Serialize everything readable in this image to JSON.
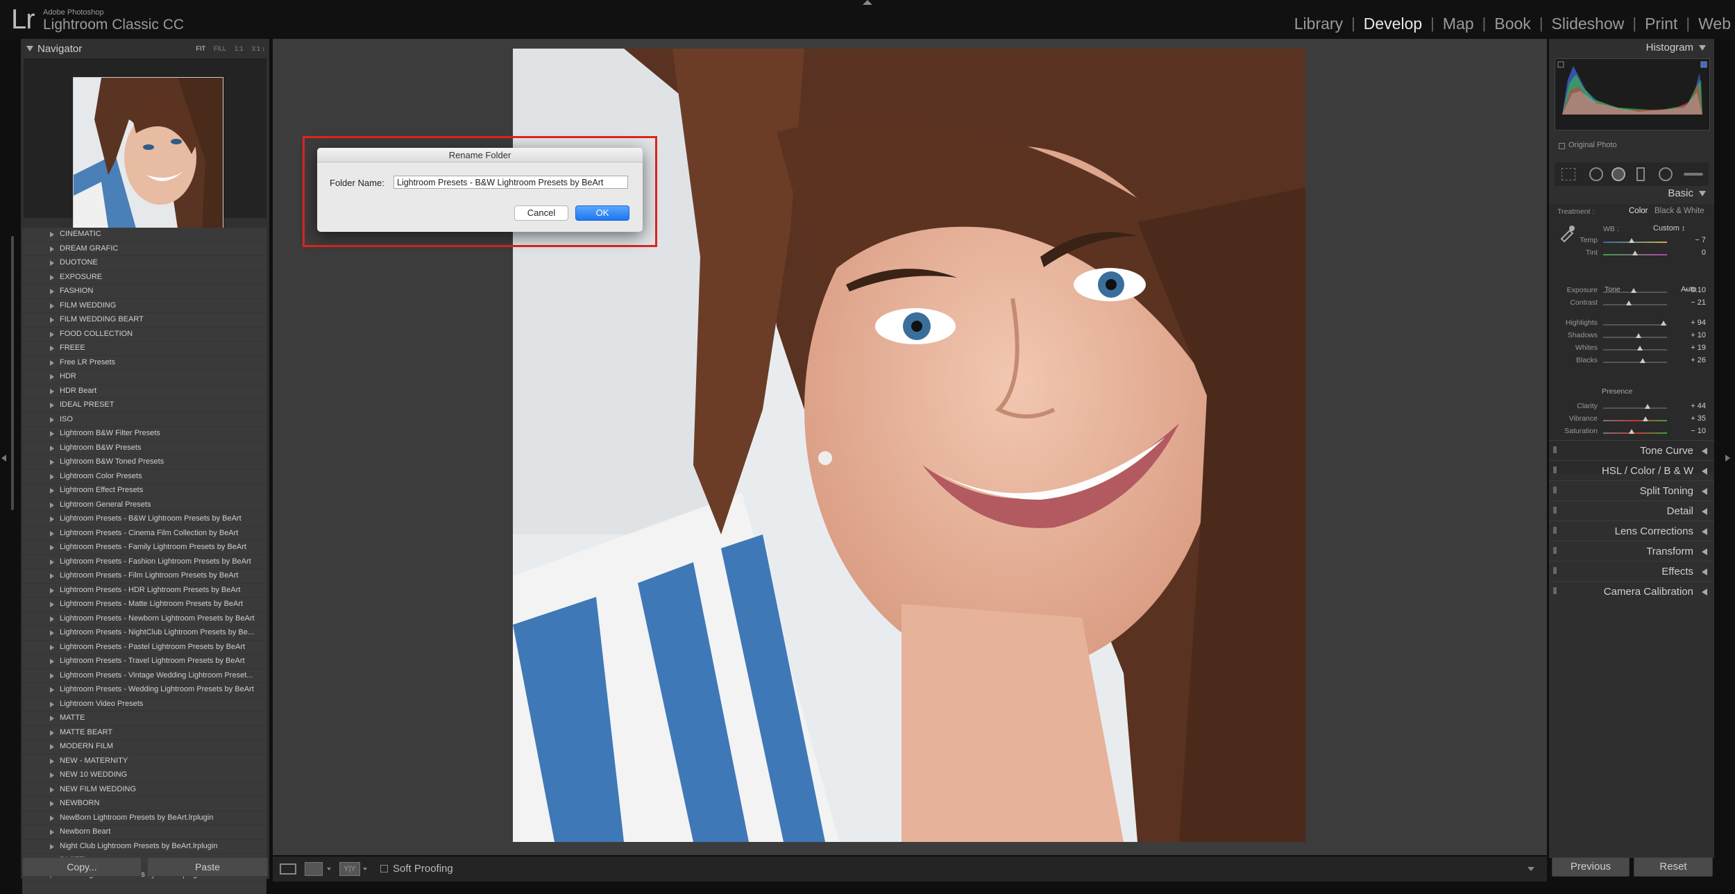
{
  "app": {
    "logo": "Lr",
    "vendor": "Adobe Photoshop",
    "name": "Lightroom Classic CC"
  },
  "modules": [
    {
      "label": "Library",
      "active": false
    },
    {
      "label": "Develop",
      "active": true
    },
    {
      "label": "Map",
      "active": false
    },
    {
      "label": "Book",
      "active": false
    },
    {
      "label": "Slideshow",
      "active": false
    },
    {
      "label": "Print",
      "active": false
    },
    {
      "label": "Web",
      "active": false
    }
  ],
  "navigator": {
    "title": "Navigator",
    "zoom_options": [
      "FIT",
      "FILL",
      "1:1",
      "3:1 ↕"
    ],
    "selected_zoom": "FIT"
  },
  "presets": [
    "CINEMATIC",
    "DREAM GRAFIC",
    "DUOTONE",
    "EXPOSURE",
    "FASHION",
    "FILM WEDDING",
    "FILM WEDDING BEART",
    "FOOD COLLECTION",
    "FREEE",
    "Free LR Presets",
    "HDR",
    "HDR Beart",
    "IDEAL PRESET",
    "ISO",
    "Lightroom B&W Filter Presets",
    "Lightroom B&W Presets",
    "Lightroom B&W Toned Presets",
    "Lightroom Color Presets",
    "Lightroom Effect Presets",
    "Lightroom General Presets",
    "Lightroom Presets - B&W Lightroom Presets by BeArt",
    "Lightroom Presets - Cinema Film Collection by BeArt",
    "Lightroom Presets - Family Lightroom Presets by BeArt",
    "Lightroom Presets - Fashion Lightroom Presets by BeArt",
    "Lightroom Presets - Film Lightroom Presets by BeArt",
    "Lightroom Presets - HDR Lightroom Presets by BeArt",
    "Lightroom Presets - Matte Lightroom Presets by BeArt",
    "Lightroom Presets - Newborn Lightroom Presets by BeArt",
    "Lightroom Presets - NightClub Lightroom Presets by Be...",
    "Lightroom Presets - Pastel Lightroom Presets by BeArt",
    "Lightroom Presets - Travel Lightroom Presets by BeArt",
    "Lightroom Presets - Vintage Wedding Lightroom Preset...",
    "Lightroom Presets - Wedding Lightroom Presets by BeArt",
    "Lightroom Video Presets",
    "MATTE",
    "MATTE BEART",
    "MODERN FILM",
    "NEW - MATERNITY",
    "NEW 10 WEDDING",
    "NEW FILM WEDDING",
    "NEWBORN",
    "NewBorn Lightroom Presets by BeArt.lrplugin",
    "Newborn Beart",
    "Night Club Lightroom Presets by BeArt.lrplugin",
    "PASTEL",
    "Pastel Lightroom Presets by BeArt.lrplugin"
  ],
  "left_footer": {
    "copy": "Copy...",
    "paste": "Paste"
  },
  "toolbar": {
    "soft_proofing": "Soft Proofing"
  },
  "dialog": {
    "title": "Rename Folder",
    "field_label": "Folder Name:",
    "field_value": "Lightroom Presets - B&W Lightroom Presets by BeArt",
    "cancel": "Cancel",
    "ok": "OK"
  },
  "right": {
    "histogram": "Histogram",
    "original_photo": "Original Photo",
    "basic": "Basic",
    "treatment_label": "Treatment :",
    "treatment_color": "Color",
    "treatment_bw": "Black & White",
    "wb_label": "WB :",
    "wb_value": "Custom ↕",
    "tone": "Tone",
    "auto": "Auto",
    "presence": "Presence",
    "sliders": [
      {
        "label": "Temp",
        "value": "− 7",
        "pos": 0.45,
        "group": "wb"
      },
      {
        "label": "Tint",
        "value": "0",
        "pos": 0.5,
        "group": "wb"
      },
      {
        "label": "Exposure",
        "value": "− 0.10",
        "pos": 0.48,
        "group": "tone"
      },
      {
        "label": "Contrast",
        "value": "− 21",
        "pos": 0.4,
        "group": "tone"
      },
      {
        "label": "Highlights",
        "value": "+ 94",
        "pos": 0.95,
        "group": "tone2"
      },
      {
        "label": "Shadows",
        "value": "+ 10",
        "pos": 0.55,
        "group": "tone2"
      },
      {
        "label": "Whites",
        "value": "+ 19",
        "pos": 0.58,
        "group": "tone2"
      },
      {
        "label": "Blacks",
        "value": "+ 26",
        "pos": 0.62,
        "group": "tone2"
      },
      {
        "label": "Clarity",
        "value": "+ 44",
        "pos": 0.7,
        "group": "presence"
      },
      {
        "label": "Vibrance",
        "value": "+ 35",
        "pos": 0.66,
        "group": "presence"
      },
      {
        "label": "Saturation",
        "value": "− 10",
        "pos": 0.45,
        "group": "presence"
      }
    ],
    "sections": [
      "Tone Curve",
      "HSL  /  Color  /  B & W",
      "Split Toning",
      "Detail",
      "Lens Corrections",
      "Transform",
      "Effects",
      "Camera Calibration"
    ],
    "previous": "Previous",
    "reset": "Reset"
  }
}
